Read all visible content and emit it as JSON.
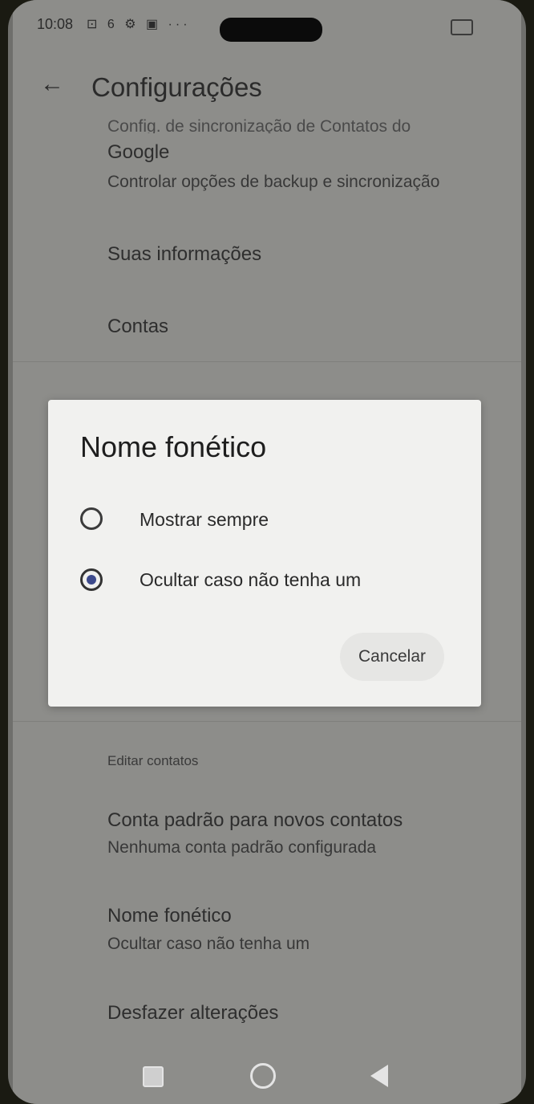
{
  "status": {
    "time": "10:08",
    "icons": "⊡ 6 ⚙ ▣ ···"
  },
  "appbar": {
    "title": "Configurações"
  },
  "settings": {
    "sync_partial": "Config. de sincronização de Contatos do",
    "sync_title": "Google",
    "sync_subtitle": "Controlar opções de backup e sincronização",
    "your_info": "Suas informações",
    "accounts": "Contas",
    "section_edit": "Editar contatos",
    "default_account_title": "Conta padrão para novos contatos",
    "default_account_subtitle": "Nenhuma conta padrão configurada",
    "phonetic_title": "Nome fonético",
    "phonetic_subtitle": "Ocultar caso não tenha um",
    "undo_changes": "Desfazer alterações"
  },
  "dialog": {
    "title": "Nome fonético",
    "options": [
      {
        "label": "Mostrar sempre",
        "selected": false
      },
      {
        "label": "Ocultar caso não tenha um",
        "selected": true
      }
    ],
    "cancel_label": "Cancelar"
  },
  "colors": {
    "radio_selected": "#3d4a8c"
  }
}
